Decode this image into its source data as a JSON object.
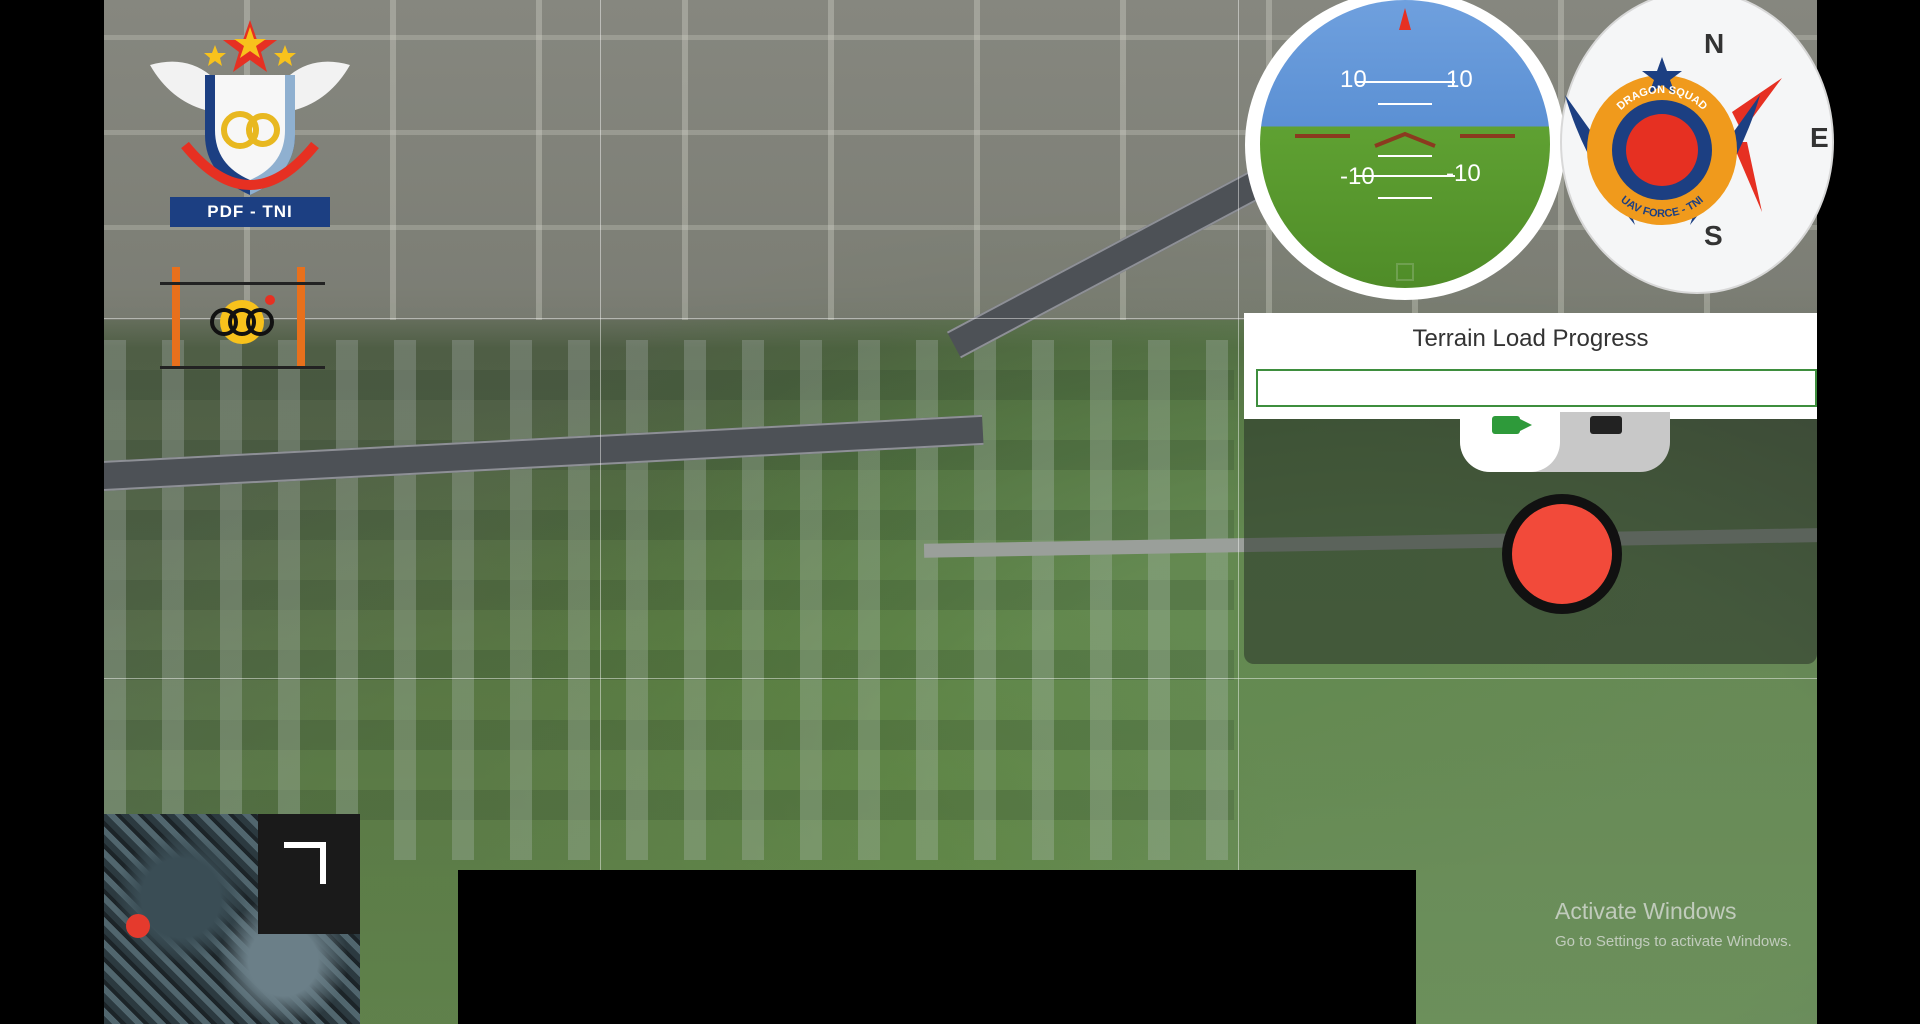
{
  "attitude_indicator": {
    "labels": {
      "top_left": "10",
      "top_right": "10",
      "bottom_left": "-10",
      "bottom_right": "-10"
    },
    "colors": {
      "sky": "#5b90d4",
      "ground": "#4f8c28",
      "horizon_marker": "#8b3a1f"
    }
  },
  "compass": {
    "north": "N",
    "south": "S",
    "east": "E"
  },
  "badge": {
    "top_text": "DRAGON SQUAD",
    "bottom_text": "UAV FORCE - TNI"
  },
  "logo": {
    "banner": "PDF - TNI"
  },
  "terrain": {
    "title": "Terrain Load Progress",
    "progress": 0
  },
  "camera": {
    "record_color": "#f24a3a",
    "mode_icons": [
      "video-icon",
      "photo-icon"
    ]
  },
  "watermark": {
    "line1": "Activate Windows",
    "line2": "Go to Settings to activate Windows."
  }
}
